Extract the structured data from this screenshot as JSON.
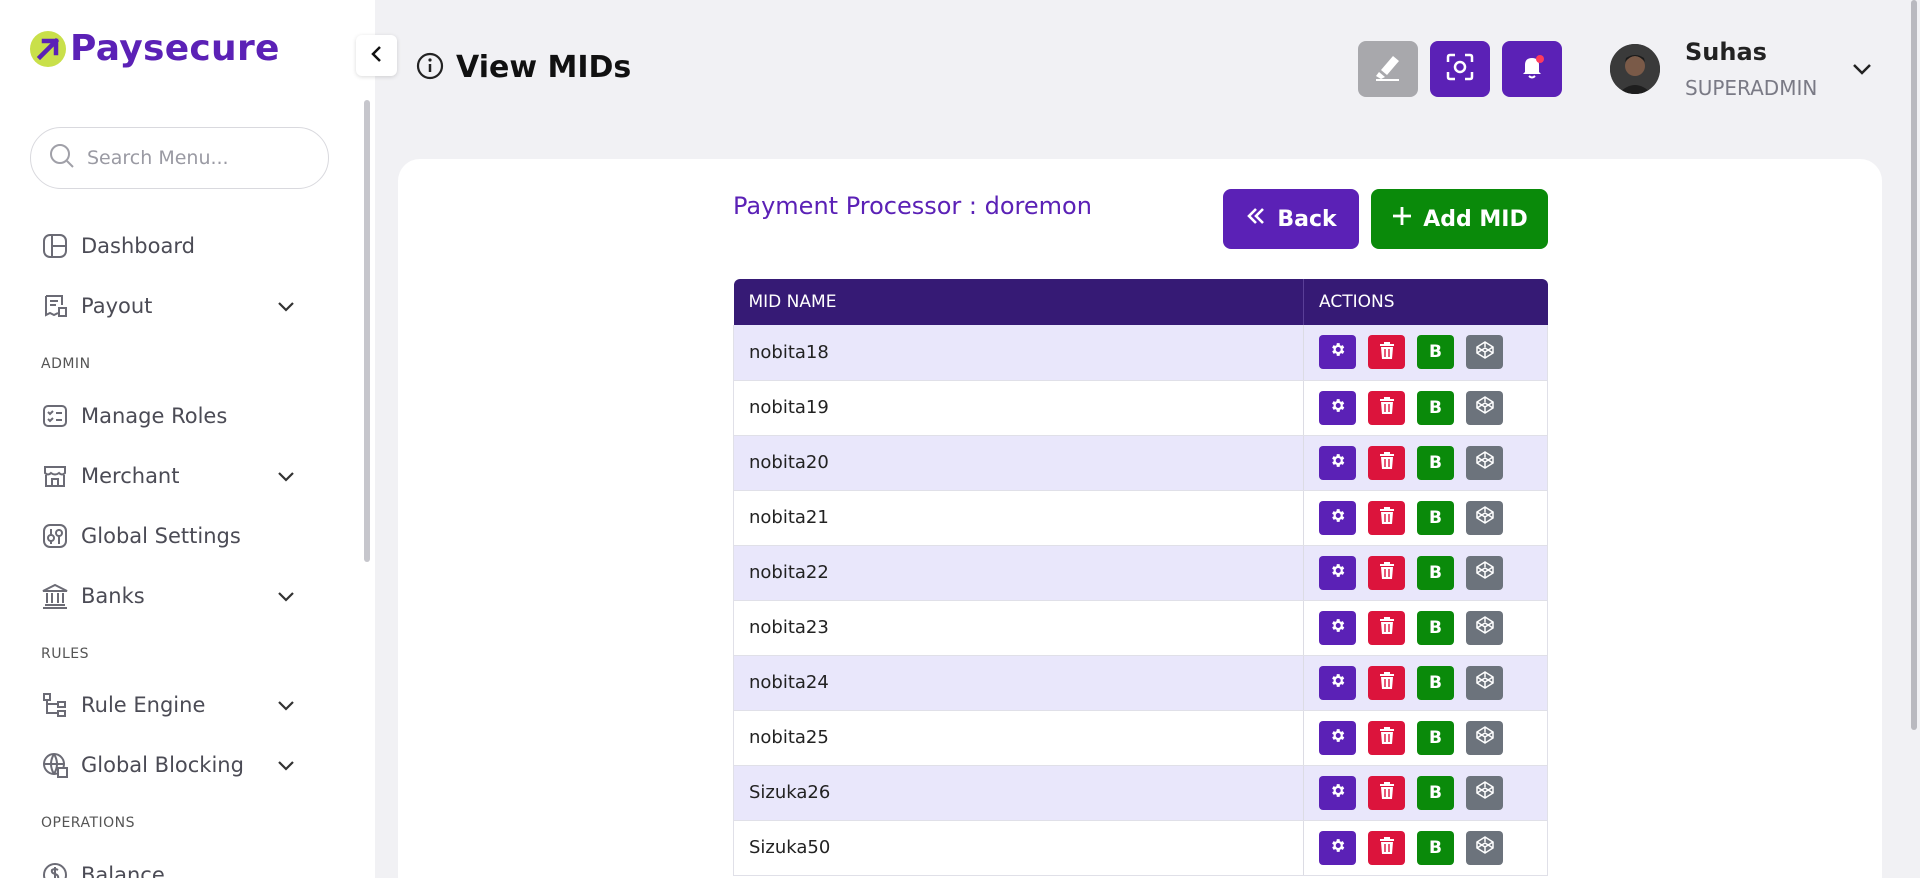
{
  "brand": {
    "name": "Paysecure"
  },
  "search": {
    "placeholder": "Search Menu..."
  },
  "sidebar": {
    "items": [
      {
        "label": "Dashboard"
      },
      {
        "label": "Payout"
      },
      {
        "label": "Manage Roles"
      },
      {
        "label": "Merchant"
      },
      {
        "label": "Global Settings"
      },
      {
        "label": "Banks"
      },
      {
        "label": "Rule Engine"
      },
      {
        "label": "Global Blocking"
      },
      {
        "label": "Balance"
      }
    ],
    "sections": {
      "admin": "ADMIN",
      "rules": "RULES",
      "operations": "OPERATIONS"
    }
  },
  "header": {
    "title": "View MIDs",
    "user": {
      "name": "Suhas",
      "role": "SUPERADMIN"
    }
  },
  "main": {
    "processor_label": "Payment Processor : doremon",
    "back_label": "Back",
    "add_label": "Add MID",
    "table": {
      "columns": [
        "MID NAME",
        "ACTIONS"
      ],
      "rows": [
        "nobita18",
        "nobita19",
        "nobita20",
        "nobita21",
        "nobita22",
        "nobita23",
        "nobita24",
        "nobita25",
        "Sizuka26",
        "Sizuka50"
      ],
      "b_label": "B"
    }
  },
  "colors": {
    "brand": "#5b21b6",
    "table_header": "#361a75",
    "danger": "#dc143c",
    "success": "#0a8a0a",
    "neutral": "#6c737c"
  },
  "icons": [
    "logo-icon",
    "chevron-left-icon",
    "search-icon",
    "dashboard-icon",
    "payout-icon",
    "chevron-down-icon",
    "roles-icon",
    "merchant-icon",
    "settings-sliders-icon",
    "bank-icon",
    "rule-engine-icon",
    "globe-block-icon",
    "balance-icon",
    "info-icon",
    "eraser-icon",
    "scan-icon",
    "bell-icon",
    "double-chevron-left-icon",
    "plus-icon",
    "gear-icon",
    "trash-icon",
    "code-icon"
  ]
}
